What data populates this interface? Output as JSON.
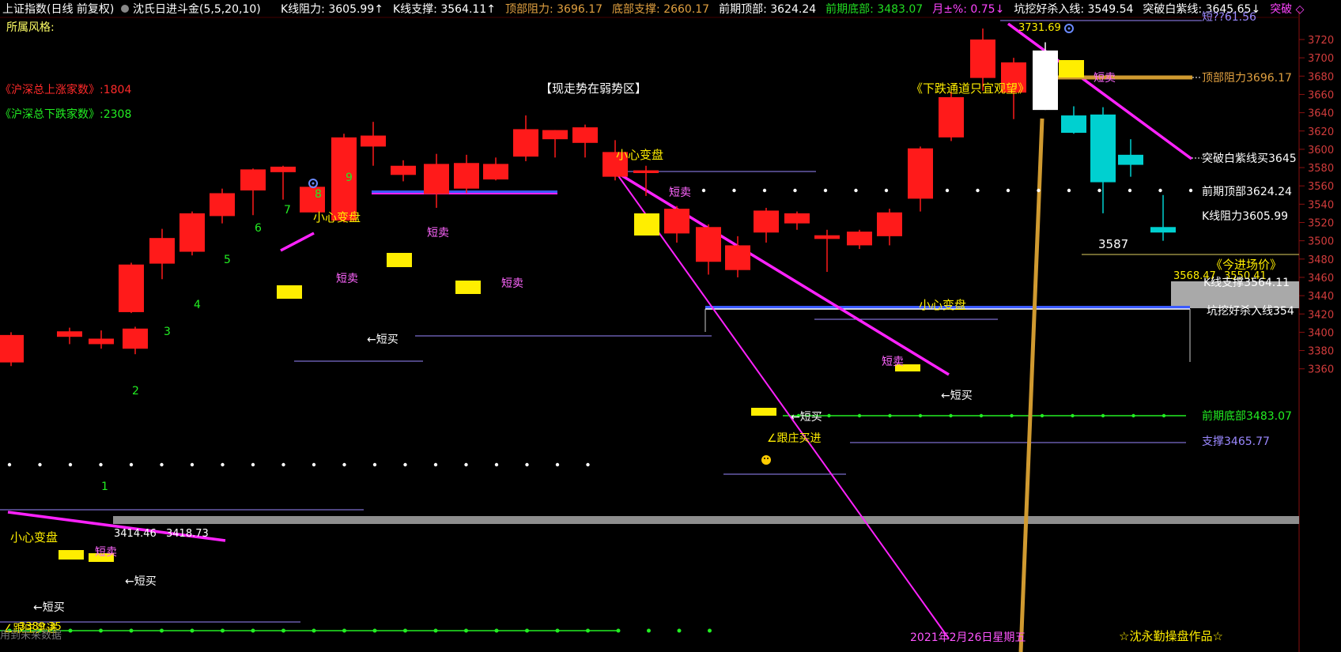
{
  "header": {
    "title": "上证指数(日线 前复权)",
    "indicator_name": "沈氏日进斗金(5,5,20,10)",
    "items": [
      {
        "label": "K线阻力:",
        "value": "3605.99",
        "arrow": "↑",
        "color": "#ffffff"
      },
      {
        "label": "K线支撑:",
        "value": "3564.11",
        "arrow": "↑",
        "color": "#ffffff"
      },
      {
        "label": "顶部阻力:",
        "value": "3696.17",
        "arrow": "",
        "color": "#e0a040"
      },
      {
        "label": "底部支撑:",
        "value": "2660.17",
        "arrow": "",
        "color": "#e0a040"
      },
      {
        "label": "前期顶部:",
        "value": "3624.24",
        "arrow": "",
        "color": "#ffffff"
      },
      {
        "label": "前期底部:",
        "value": "3483.07",
        "arrow": "",
        "color": "#22dd22"
      },
      {
        "label": "月±%:",
        "value": "0.75",
        "arrow": "↓",
        "color": "#ff44ff"
      },
      {
        "label": "坑挖好杀入线:",
        "value": "3549.54",
        "arrow": "",
        "color": "#ffffff"
      },
      {
        "label": "突破白紫线:",
        "value": "3645.65",
        "arrow": "↓",
        "color": "#ffffff"
      },
      {
        "label": "突破",
        "value": "◇",
        "arrow": "",
        "color": "#ff44ff"
      }
    ],
    "style_label": "所属风格:"
  },
  "left_stats": {
    "up_count": "《沪深总上涨家数》:1804",
    "down_count": "《沪深总下跌家数》:2308"
  },
  "annotations": {
    "weak_zone": "【现走势在弱势区】",
    "down_channel": "《下跌通道只宜观望》",
    "careful_1": "小心变盘",
    "careful_2": "小心变盘",
    "careful_3": "小心变盘",
    "careful_4": "小心变盘",
    "short_sell": "短卖",
    "short_buy": "←短买",
    "follow_buy": "∠跟庄买进",
    "follow_buy_2": "∠跟庄买进",
    "entry_price": "《今进场价》",
    "price_3587": "3587",
    "price_3568": "3568.47",
    "price_3550": "3550.41",
    "price_3414": "3414.46",
    "price_3418": "3418.73",
    "price_3731": "3731.69",
    "price_3389": "3389.35",
    "date": "2021年2月26日星期五",
    "author": "☆沈永勤操盘作品☆",
    "footer_left": "用到未来数据",
    "seq": [
      "1",
      "2",
      "3",
      "4",
      "5",
      "6",
      "7",
      "8",
      "9"
    ]
  },
  "right_labels": {
    "top_resist": "顶部阻力3696.17",
    "break_line": "突破白紫线买3645",
    "prev_top": "前期顶部3624.24",
    "k_resist": "K线阻力3605.99",
    "k_support": "K线支撑3564.11",
    "dig_line": "坑挖好杀入线354",
    "prev_bottom": "前期底部3483.07",
    "support": "支撑3465.77",
    "top_cut": "短??61.56"
  },
  "chart_data": {
    "type": "candlestick",
    "y_axis_ticks": [
      3360,
      3380,
      3400,
      3420,
      3440,
      3460,
      3480,
      3500,
      3520,
      3540,
      3560,
      3580,
      3600,
      3620,
      3640,
      3660,
      3680,
      3700,
      3720
    ],
    "ylim": [
      3346,
      3737
    ],
    "candles": [
      {
        "o": 3397,
        "c": 3367,
        "h": 3400,
        "l": 3363,
        "color": "red"
      },
      {
        "o": 3401,
        "c": 3395,
        "h": 3405,
        "l": 3387,
        "color": "red"
      },
      {
        "o": 3393,
        "c": 3387,
        "h": 3402,
        "l": 3382,
        "color": "red"
      },
      {
        "o": 3382,
        "c": 3404,
        "h": 3406,
        "l": 3376,
        "color": "red"
      },
      {
        "o": 3422,
        "c": 3474,
        "h": 3476,
        "l": 3421,
        "color": "red"
      },
      {
        "o": 3475,
        "c": 3503,
        "h": 3513,
        "l": 3458,
        "color": "red"
      },
      {
        "o": 3488,
        "c": 3530,
        "h": 3532,
        "l": 3484,
        "color": "red"
      },
      {
        "o": 3527,
        "c": 3552,
        "h": 3557,
        "l": 3519,
        "color": "red"
      },
      {
        "o": 3555,
        "c": 3578,
        "h": 3579,
        "l": 3528,
        "color": "red"
      },
      {
        "o": 3575,
        "c": 3581,
        "h": 3582,
        "l": 3545,
        "color": "red"
      },
      {
        "o": 3559,
        "c": 3531,
        "h": 3560,
        "l": 3531,
        "color": "red"
      },
      {
        "o": 3522,
        "c": 3613,
        "h": 3617,
        "l": 3520,
        "color": "red"
      },
      {
        "o": 3615,
        "c": 3603,
        "h": 3630,
        "l": 3582,
        "color": "red"
      },
      {
        "o": 3582,
        "c": 3572,
        "h": 3588,
        "l": 3565,
        "color": "red"
      },
      {
        "o": 3584,
        "c": 3551,
        "h": 3595,
        "l": 3536,
        "color": "red"
      },
      {
        "o": 3585,
        "c": 3557,
        "h": 3594,
        "l": 3552,
        "color": "red"
      },
      {
        "o": 3584,
        "c": 3567,
        "h": 3591,
        "l": 3566,
        "color": "red"
      },
      {
        "o": 3622,
        "c": 3592,
        "h": 3637,
        "l": 3587,
        "color": "red"
      },
      {
        "o": 3621,
        "c": 3611,
        "h": 3621,
        "l": 3591,
        "color": "red"
      },
      {
        "o": 3624,
        "c": 3607,
        "h": 3627,
        "l": 3591,
        "color": "red"
      },
      {
        "o": 3597,
        "c": 3570,
        "h": 3610,
        "l": 3566,
        "color": "red"
      },
      {
        "o": 3577,
        "c": 3574,
        "h": 3582,
        "l": 3549,
        "color": "red"
      },
      {
        "o": 3535,
        "c": 3508,
        "h": 3538,
        "l": 3498,
        "color": "red"
      },
      {
        "o": 3515,
        "c": 3477,
        "h": 3518,
        "l": 3463,
        "color": "red"
      },
      {
        "o": 3495,
        "c": 3468,
        "h": 3505,
        "l": 3460,
        "color": "red"
      },
      {
        "o": 3509,
        "c": 3533,
        "h": 3536,
        "l": 3498,
        "color": "red"
      },
      {
        "o": 3530,
        "c": 3519,
        "h": 3532,
        "l": 3512,
        "color": "red"
      },
      {
        "o": 3506,
        "c": 3502,
        "h": 3512,
        "l": 3466,
        "color": "red"
      },
      {
        "o": 3510,
        "c": 3495,
        "h": 3512,
        "l": 3491,
        "color": "red"
      },
      {
        "o": 3531,
        "c": 3505,
        "h": 3535,
        "l": 3495,
        "color": "red"
      },
      {
        "o": 3546,
        "c": 3601,
        "h": 3603,
        "l": 3532,
        "color": "red"
      },
      {
        "o": 3613,
        "c": 3657,
        "h": 3663,
        "l": 3609,
        "color": "red"
      },
      {
        "o": 3678,
        "c": 3720,
        "h": 3732,
        "l": 3664,
        "color": "red"
      },
      {
        "o": 3662,
        "c": 3695,
        "h": 3700,
        "l": 3633,
        "color": "red"
      },
      {
        "o": 3708,
        "c": 3643,
        "h": 3717,
        "l": 3643,
        "color": "white"
      },
      {
        "o": 3637,
        "c": 3618,
        "h": 3647,
        "l": 3617,
        "color": "cyan"
      },
      {
        "o": 3638,
        "c": 3564,
        "h": 3646,
        "l": 3530,
        "color": "cyan"
      },
      {
        "o": 3594,
        "c": 3583,
        "h": 3611,
        "l": 3570,
        "color": "cyan"
      },
      {
        "o": 3515,
        "c": 3509,
        "h": 3550,
        "l": 3500,
        "color": "cyan"
      }
    ]
  },
  "colors": {
    "up": "#ff1a1a",
    "down_cyan": "#00d0d0",
    "magenta": "#ff22ff",
    "gold": "#d09a30",
    "green": "#22ee22",
    "yellow": "#ffee00",
    "purple": "#9a88ff",
    "axis_text": "#d23c3c"
  }
}
